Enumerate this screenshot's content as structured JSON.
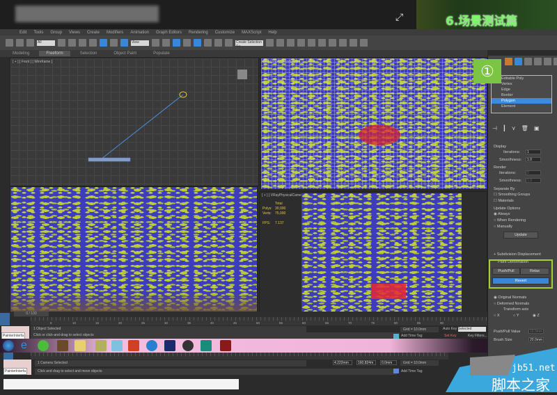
{
  "banner": {
    "title": "6.场景测试篇"
  },
  "menu": [
    "Edit",
    "Tools",
    "Group",
    "Views",
    "Create",
    "Modifiers",
    "Animation",
    "Graph Editors",
    "Rendering",
    "Customize",
    "MAXScript",
    "Help"
  ],
  "toolbar": {
    "filter_value": "All",
    "view_value": "View",
    "selection_set": "Create Selection Se"
  },
  "ribbon": [
    "Modeling",
    "Freeform",
    "Selection",
    "Object Paint",
    "Populate"
  ],
  "viewports": {
    "front_label": "[ + ] [ Front ] [ Wireframe ]",
    "top_label": "[ + ] [ Top ] [ Wireframe ]",
    "camera_label": "[ + ] [ VRayPhysicalCamera001 ]",
    "stats": {
      "total_label": "Total",
      "polys_label": "Polys:",
      "polys": "30,000",
      "verts_label": "Verts:",
      "verts": "75,000",
      "fps_label": "FPS:",
      "fps": "7.137"
    }
  },
  "badge": "①",
  "panel": {
    "stack": [
      "Editable Poly",
      "Vertex",
      "Edge",
      "Border",
      "Polygon",
      "Element"
    ],
    "display_label": "Display",
    "iterations_label": "Iterations:",
    "iterations": "1",
    "smoothness_label": "Smoothness:",
    "smoothness": "1.0",
    "render_label": "Render",
    "render_iterations": "0",
    "render_smoothness": "1.0",
    "separate_label": "Separate By",
    "smoothing_groups": "Smoothing Groups",
    "materials": "Materials",
    "update_label": "Update Options",
    "always": "Always",
    "when_rendering": "When Rendering",
    "manually": "Manually",
    "update_btn": "Update",
    "subdiv_disp": "Subdivision Displacement",
    "paint_deform": "Paint Deformation",
    "push_pull": "Push/Pull",
    "relax": "Relax",
    "revert": "Revert",
    "original_normals": "Original Normals",
    "deformed_normals": "Deformed Normals",
    "transform_axis": "Transform axis",
    "axis_x": "X",
    "axis_y": "Y",
    "axis_z": "Z",
    "push_pull_value_label": "Push/Pull Value",
    "push_pull_value": "10.0mm",
    "brush_size_label": "Brush Size",
    "brush_size": "20.0mm"
  },
  "timeline": {
    "frame": "0 / 100",
    "ticks": [
      "5",
      "10",
      "15",
      "20",
      "25",
      "30",
      "35",
      "40",
      "45",
      "50",
      "55",
      "60",
      "65",
      "70",
      "75",
      "80",
      "85",
      "90"
    ]
  },
  "status1": {
    "maxscript": "PainterInterfa",
    "selected": "1 Object Selected",
    "prompt": "Click or click-and-drag to select objects",
    "grid": "Grid = 10.0mm",
    "auto_key": "Auto Key",
    "key_mode": "Selected",
    "set_key": "Set Key",
    "key_filters": "Key Filters...",
    "add_time_tag": "Add Time Tag"
  },
  "status2": {
    "maxscript": "PainterInterfa",
    "selected": "1 Camera Selected",
    "prompt": "Click and drag to select and move objects",
    "x": "4.222mm",
    "y": "160.824m",
    "z": "0.0mm",
    "grid": "Grid = 10.0mm",
    "add_time_tag": "Add Time Tag"
  },
  "watermark": {
    "site": "jb51.net",
    "name": "脚本之家"
  },
  "colors": {
    "accent": "#3a86d8",
    "highlight": "#a6d131",
    "badge": "#7cc443"
  }
}
